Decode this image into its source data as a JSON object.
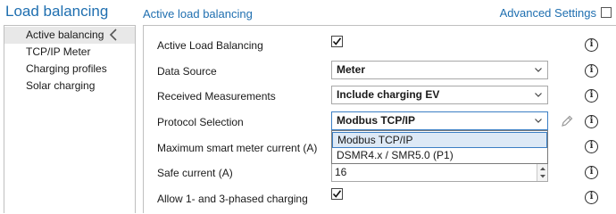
{
  "header": {
    "app_title": "Load balancing",
    "section_title": "Active load balancing",
    "advanced_label": "Advanced Settings"
  },
  "sidebar": {
    "items": [
      {
        "label": "Active balancing",
        "active": true
      },
      {
        "label": "TCP/IP Meter",
        "active": false
      },
      {
        "label": "Charging profiles",
        "active": false
      },
      {
        "label": "Solar charging",
        "active": false
      }
    ]
  },
  "form": {
    "active_load_balancing": {
      "label": "Active Load Balancing",
      "checked": true
    },
    "data_source": {
      "label": "Data Source",
      "value": "Meter"
    },
    "received_measurements": {
      "label": "Received Measurements",
      "value": "Include charging EV"
    },
    "protocol_selection": {
      "label": "Protocol Selection",
      "value": "Modbus TCP/IP",
      "options": [
        "Modbus TCP/IP",
        "DSMR4.x / SMR5.0 (P1)"
      ]
    },
    "max_smart_meter_current": {
      "label": "Maximum smart meter current (A)"
    },
    "safe_current": {
      "label": "Safe current (A)",
      "value": "16"
    },
    "allow_phases": {
      "label": "Allow 1- and 3-phased charging",
      "checked": true
    }
  },
  "icons": {
    "info": "i",
    "colors": {
      "accent": "#1f6fb0",
      "selection": "#dde9f6",
      "selection_border": "#3c7fc4"
    }
  }
}
